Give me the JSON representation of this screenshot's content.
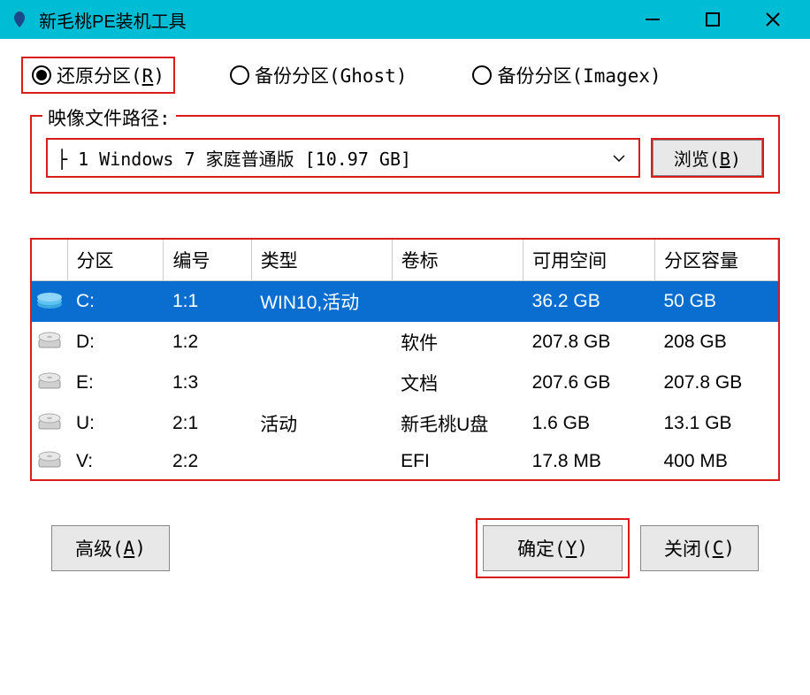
{
  "titlebar": {
    "title": "新毛桃PE装机工具"
  },
  "radios": {
    "restore": "还原分区(R)",
    "backup_ghost": "备份分区(Ghost)",
    "backup_imagex": "备份分区(Imagex)"
  },
  "image_path": {
    "legend": "映像文件路径:",
    "selected": "├ 1 Windows 7 家庭普通版 [10.97 GB]",
    "browse": "浏览(B)"
  },
  "table": {
    "headers": {
      "partition": "分区",
      "number": "编号",
      "type": "类型",
      "label": "卷标",
      "free": "可用空间",
      "size": "分区容量"
    },
    "rows": [
      {
        "drive": "C:",
        "num": "1:1",
        "type": "WIN10,活动",
        "label": "",
        "free": "36.2 GB",
        "size": "50 GB",
        "selected": true,
        "icon": "blue"
      },
      {
        "drive": "D:",
        "num": "1:2",
        "type": "",
        "label": "软件",
        "free": "207.8 GB",
        "size": "208 GB",
        "selected": false,
        "icon": "gray"
      },
      {
        "drive": "E:",
        "num": "1:3",
        "type": "",
        "label": "文档",
        "free": "207.6 GB",
        "size": "207.8 GB",
        "selected": false,
        "icon": "gray"
      },
      {
        "drive": "U:",
        "num": "2:1",
        "type": "活动",
        "label": "新毛桃U盘",
        "free": "1.6 GB",
        "size": "13.1 GB",
        "selected": false,
        "icon": "gray"
      },
      {
        "drive": "V:",
        "num": "2:2",
        "type": "",
        "label": "EFI",
        "free": "17.8 MB",
        "size": "400 MB",
        "selected": false,
        "icon": "gray"
      }
    ]
  },
  "footer": {
    "advanced": "高级(A)",
    "ok": "确定(Y)",
    "close": "关闭(C)"
  }
}
